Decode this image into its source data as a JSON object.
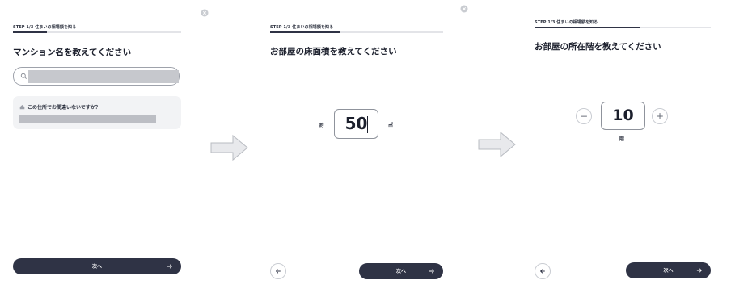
{
  "screens": [
    {
      "step_text": "STEP 1/3  住まいの相場額を知る",
      "progress": 0.2,
      "title": "マンション名を教えてください",
      "search": {
        "icon": "search-icon"
      },
      "confirm": {
        "question": "この住所でお間違いないですか？",
        "icon": "house-icon"
      },
      "next_label": "次へ"
    },
    {
      "step_text": "STEP 1/3  住まいの相場額を知る",
      "progress": 0.4,
      "title": "お部屋の床面積を教えてください",
      "prefix": "約",
      "value": "50",
      "unit": "㎡",
      "next_label": "次へ"
    },
    {
      "step_text": "STEP 1/3  住まいの相場額を知る",
      "progress": 0.6,
      "title": "お部屋の所在階を教えてください",
      "minus": "−",
      "value": "10",
      "plus": "+",
      "unit": "階",
      "next_label": "次へ"
    }
  ],
  "colors": {
    "primary": "#2f3345",
    "track": "#e3e4e8",
    "redacted": "#c6c8cd",
    "card": "#f2f3f5",
    "arrow": "#c4c7cc"
  }
}
